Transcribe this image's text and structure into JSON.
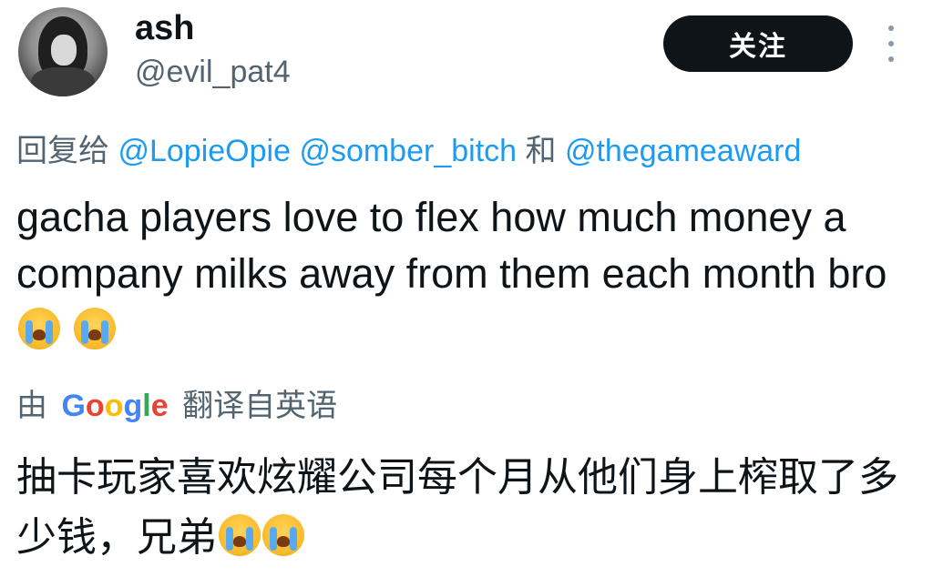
{
  "author": {
    "display_name": "ash",
    "handle": "@evil_pat4"
  },
  "follow_button": {
    "label": "关注"
  },
  "reply_context": {
    "prefix": "回复给",
    "mentions": [
      "@LopieOpie",
      "@somber_bitch"
    ],
    "conjunction": "和",
    "last_mention": "@thegameaward"
  },
  "tweet": {
    "text": "gacha players love to flex how much money a company milks away from them each month bro",
    "emojis": [
      "loudly-crying-face",
      "loudly-crying-face"
    ]
  },
  "translation": {
    "prefix": "由",
    "provider_letters": [
      "G",
      "o",
      "o",
      "g",
      "l",
      "e"
    ],
    "suffix": "翻译自英语",
    "text": "抽卡玩家喜欢炫耀公司每个月从他们身上榨取了多少钱，兄弟",
    "emojis": [
      "loudly-crying-face",
      "loudly-crying-face"
    ]
  },
  "colors": {
    "link": "#1d9bf0",
    "secondary_text": "#536471",
    "button_bg": "#0f1419"
  }
}
